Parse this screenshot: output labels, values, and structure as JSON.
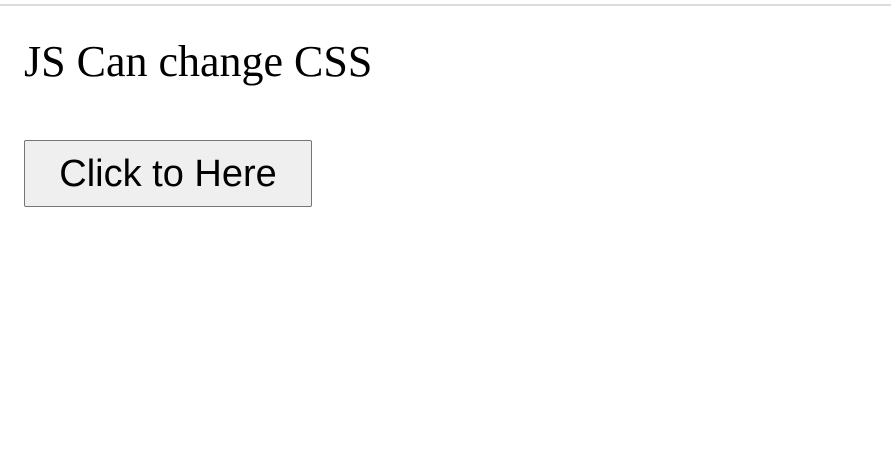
{
  "page": {
    "heading": "JS Can change CSS",
    "button_label": "Click to Here"
  }
}
